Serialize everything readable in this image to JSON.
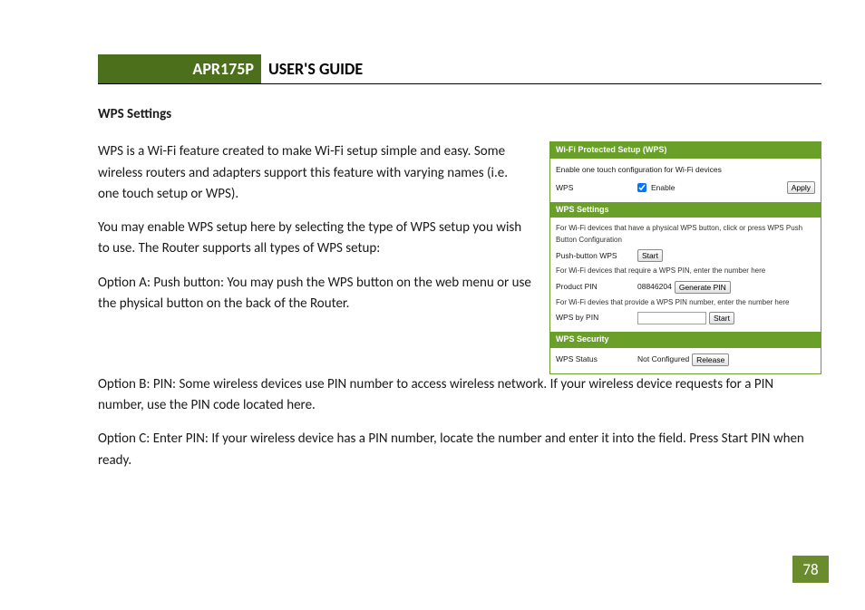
{
  "header": {
    "model": "APR175P",
    "title": "USER'S GUIDE"
  },
  "section": {
    "subhead": "WPS Settings",
    "para1": "WPS is a Wi-Fi feature created to make Wi-Fi setup simple and easy. Some wireless routers and adapters support this feature with varying names (i.e. one touch setup or WPS).",
    "para2": "You may enable WPS setup here by selecting the type of WPS setup you wish to use. The Router supports all types of WPS setup:",
    "para3": "Option A: Push button: You may push the WPS button on the web menu or use the physical button on the back of the Router.",
    "para4": "Option B: PIN: Some wireless devices use PIN number to access wireless network.  If your wireless device requests for a PIN number, use the PIN code located here.",
    "para5": "Option C: Enter PIN: If your wireless device has a PIN number, locate the number and enter it into the field. Press Start PIN when ready."
  },
  "panel": {
    "h1": "Wi-Fi Protected Setup (WPS)",
    "desc": "Enable one touch configuration for Wi-Fi devices",
    "row_wps_label": "WPS",
    "row_wps_check": "Enable",
    "row_wps_apply": "Apply",
    "h2": "WPS Settings",
    "note1": "For Wi-Fi devices that have a physical WPS button, click or press WPS Push Button Configuration",
    "row_push_label": "Push-button WPS",
    "row_push_btn": "Start",
    "note2": "For Wi-Fi devices that require a WPS PIN, enter the number here",
    "row_pin_label": "Product PIN",
    "row_pin_value": "08846204",
    "row_pin_btn": "Generate PIN",
    "note3": "For Wi-Fi devies that provide a WPS PIN number, enter the number here",
    "row_bypin_label": "WPS by PIN",
    "row_bypin_btn": "Start",
    "h3": "WPS Security",
    "row_status_label": "WPS Status",
    "row_status_value": "Not Configured",
    "row_status_btn": "Release"
  },
  "page_number": "78"
}
